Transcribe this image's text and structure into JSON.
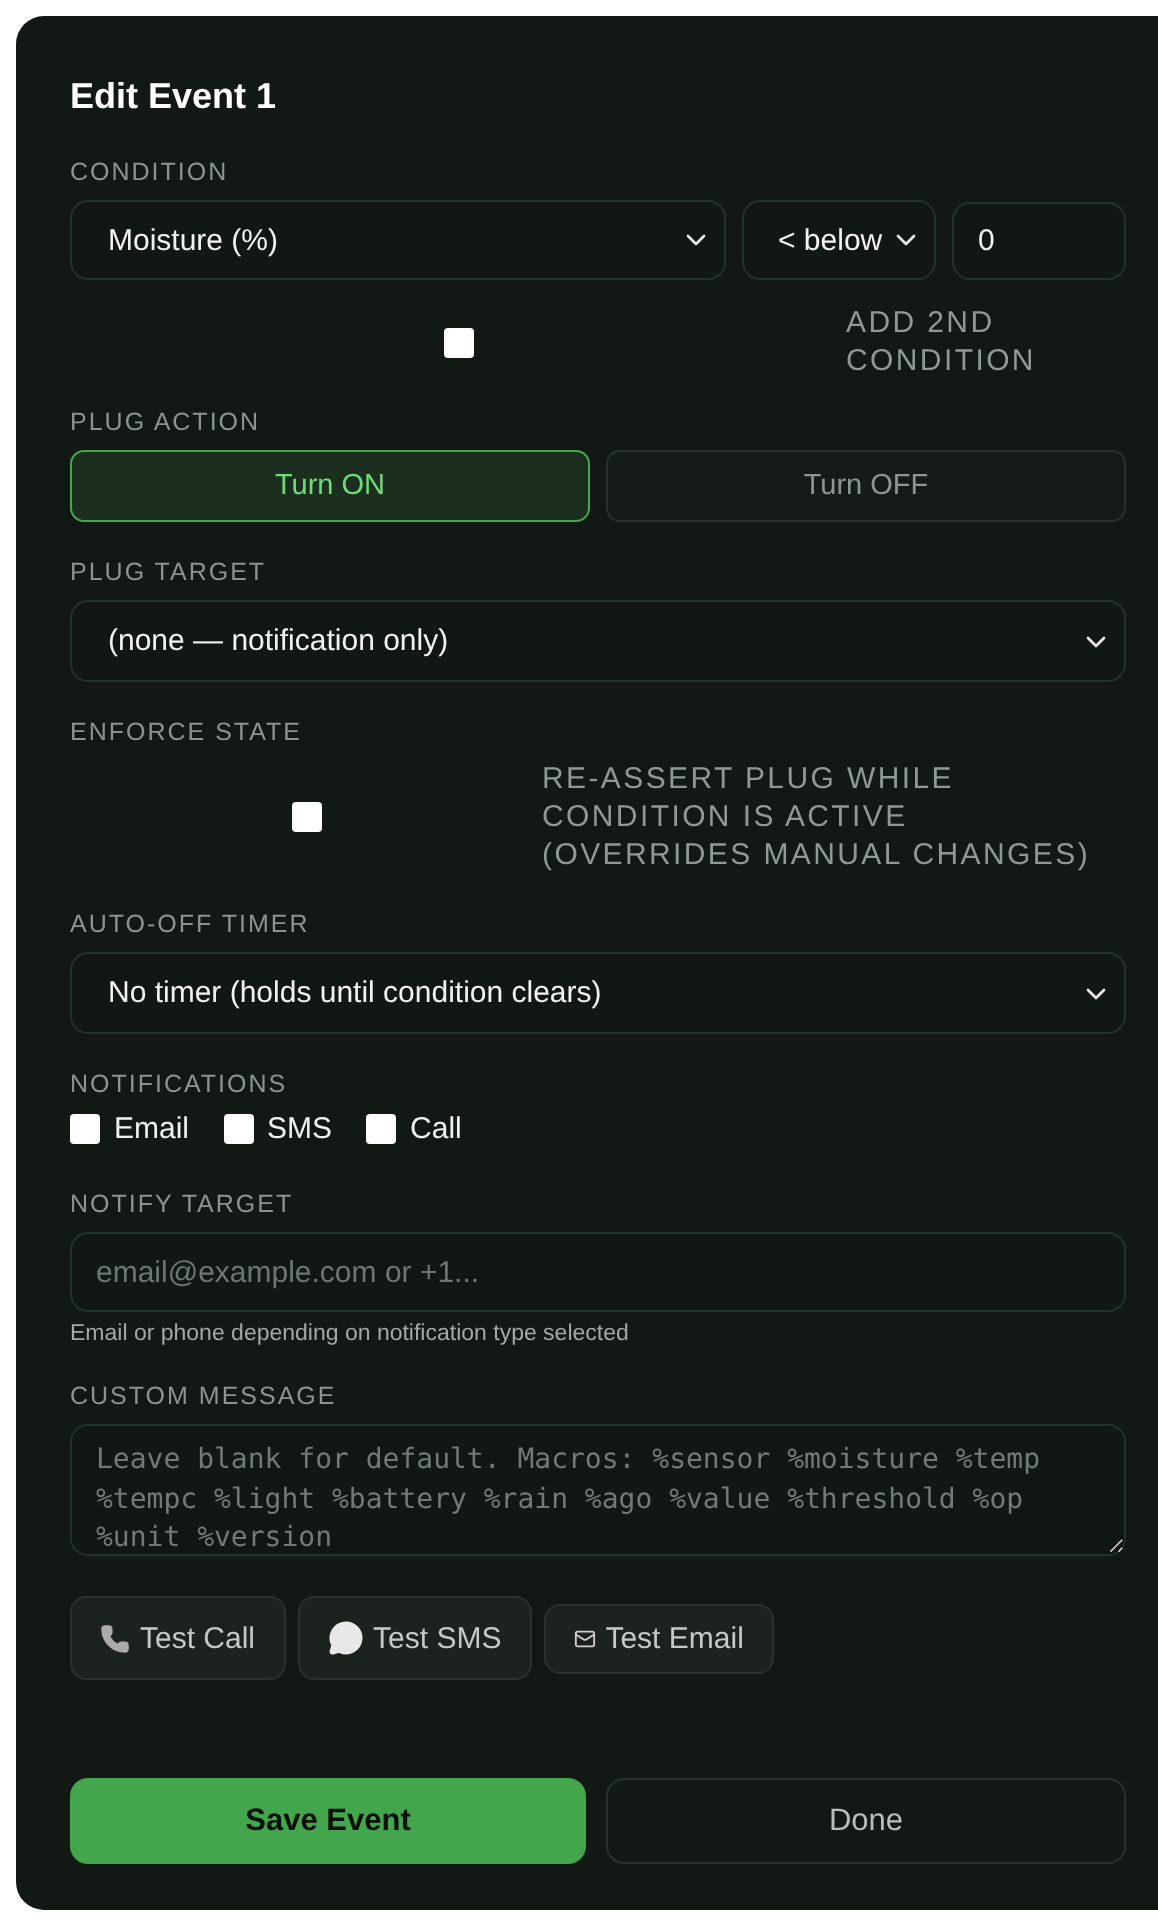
{
  "title": "Edit Event 1",
  "condition": {
    "label": "CONDITION",
    "sensor": "Moisture (%)",
    "operator": "< below",
    "threshold": "0"
  },
  "second_condition": {
    "label": "ADD 2ND CONDITION",
    "checked": false
  },
  "plug_action": {
    "label": "PLUG ACTION",
    "options": [
      {
        "label": "Turn ON",
        "selected": true
      },
      {
        "label": "Turn OFF",
        "selected": false
      }
    ]
  },
  "plug_target": {
    "label": "PLUG TARGET",
    "value": "(none — notification only)"
  },
  "enforce_state": {
    "label": "ENFORCE STATE",
    "option": "RE-ASSERT PLUG WHILE CONDITION IS ACTIVE (OVERRIDES MANUAL CHANGES)",
    "checked": false
  },
  "auto_off_timer": {
    "label": "AUTO-OFF TIMER",
    "value": "No timer (holds until condition clears)"
  },
  "notifications": {
    "label": "NOTIFICATIONS",
    "items": [
      {
        "label": "Email",
        "checked": false
      },
      {
        "label": "SMS",
        "checked": false
      },
      {
        "label": "Call",
        "checked": false
      }
    ]
  },
  "notify_target": {
    "label": "NOTIFY TARGET",
    "placeholder": "email@example.com or +1...",
    "help": "Email or phone depending on notification type selected"
  },
  "custom_message": {
    "label": "CUSTOM MESSAGE",
    "placeholder": "Leave blank for default. Macros: %sensor %moisture %temp %tempc %light %battery %rain %ago %value %threshold %op %unit %version"
  },
  "test_buttons": [
    {
      "kind": "call",
      "label": "Test Call"
    },
    {
      "kind": "sms",
      "label": "Test SMS"
    },
    {
      "kind": "email",
      "label": "Test Email"
    }
  ],
  "footer": {
    "save": "Save Event",
    "done": "Done"
  }
}
